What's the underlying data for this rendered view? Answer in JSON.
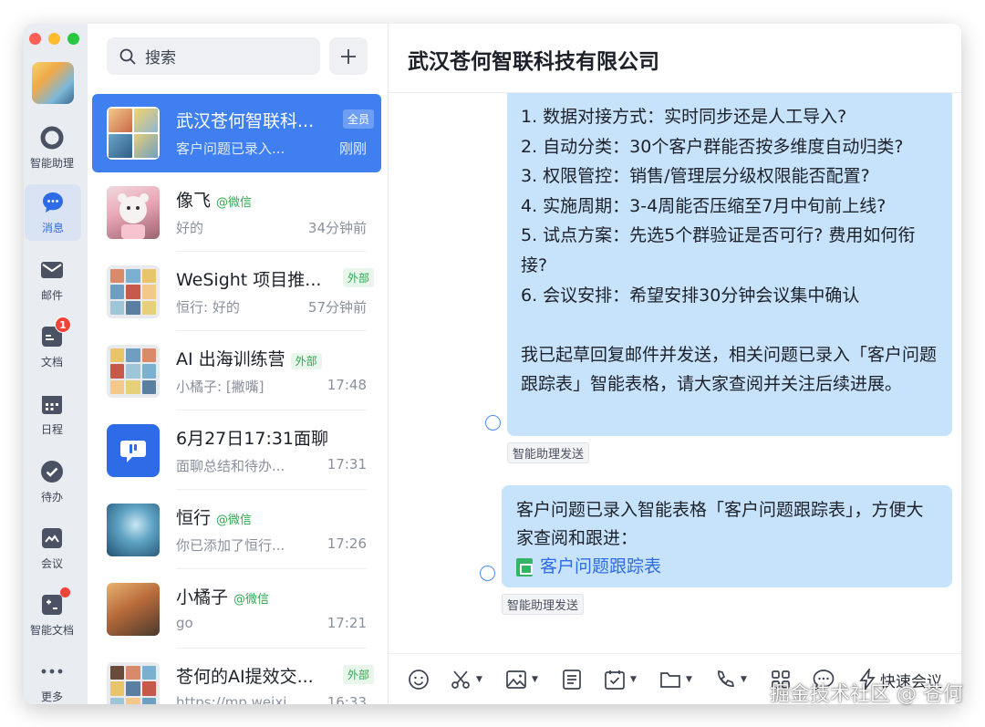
{
  "colors": {
    "accent": "#3f7ff0",
    "bubble": "#c7e2fb",
    "external_tag": "#2fa84f",
    "badge": "#f04438",
    "traffic_red": "#fe5f57",
    "traffic_yellow": "#febc2e",
    "traffic_green": "#28c840"
  },
  "sidebar": {
    "items": [
      {
        "label": "智能助理",
        "icon": "assistant-ring-icon"
      },
      {
        "label": "消息",
        "icon": "message-bubble-icon",
        "active": true
      },
      {
        "label": "邮件",
        "icon": "mail-icon"
      },
      {
        "label": "文档",
        "icon": "document-icon",
        "badge": "1"
      },
      {
        "label": "日程",
        "icon": "calendar-icon"
      },
      {
        "label": "待办",
        "icon": "todo-check-icon"
      },
      {
        "label": "会议",
        "icon": "meeting-icon"
      },
      {
        "label": "智能文档",
        "icon": "smart-doc-icon"
      },
      {
        "label": "更多",
        "icon": "more-dots-icon"
      }
    ]
  },
  "search": {
    "placeholder": "搜索"
  },
  "conversations": [
    {
      "name": "武汉苍何智联科...",
      "tag_box": "全员",
      "preview": "客户问题已录入...",
      "time": "刚刚"
    },
    {
      "name": "像飞",
      "tag": "@微信",
      "preview": "好的",
      "time": "34分钟前"
    },
    {
      "name": "WeSight 项目推...",
      "tag_box": "外部",
      "preview": "恒行: 好的",
      "time": "57分钟前"
    },
    {
      "name": "AI 出海训练营",
      "tag_box": "外部",
      "preview": "小橘子: [撇嘴]",
      "time": "17:48"
    },
    {
      "name": "6月27日17:31面聊",
      "preview": "面聊总结和待办...",
      "time": "17:31"
    },
    {
      "name": "恒行",
      "tag": "@微信",
      "preview": "你已添加了恒行...",
      "time": "17:26"
    },
    {
      "name": "小橘子",
      "tag": "@微信",
      "preview": "go",
      "time": "17:21"
    },
    {
      "name": "苍何的AI提效交...",
      "tag_box": "外部",
      "preview": "https://mp.weixi...",
      "time": "16:33"
    }
  ],
  "chat": {
    "title": "武汉苍何智联科技有限公司",
    "message1": {
      "lines": [
        "1. 数据对接方式：实时同步还是人工导入?",
        "2. 自动分类：30个客户群能否按多维度自动归类?",
        "3. 权限管控：销售/管理层分级权限能否配置?",
        "4. 实施周期：3-4周能否压缩至7月中旬前上线?",
        "5. 试点方案：先选5个群验证是否可行? 费用如何衔接?",
        "6. 会议安排：希望安排30分钟会议集中确认"
      ],
      "closing": "我已起草回复邮件并发送，相关问题已录入「客户问题跟踪表」智能表格，请大家查阅并关注后续进展。",
      "sender": "智能助理发送"
    },
    "message2": {
      "text": "客户问题已录入智能表格「客户问题跟踪表」，方便大家查阅和跟进：",
      "link": "客户问题跟踪表",
      "sender": "智能助理发送"
    }
  },
  "toolbar": {
    "quick_meeting": "快速会议"
  },
  "watermark": "掘金技术社区 @ 苍何"
}
